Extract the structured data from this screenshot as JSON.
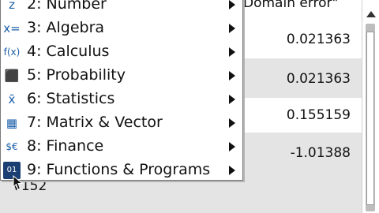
{
  "history": {
    "error_text": "Domain error\"",
    "results": [
      "0.021363",
      "0.021363",
      "0.155159",
      "-1.01388"
    ],
    "input_expr": "√152"
  },
  "menu": {
    "items": [
      {
        "icon": "number-icon",
        "glyph": "z",
        "label": "2: Number"
      },
      {
        "icon": "algebra-icon",
        "glyph": "x=",
        "label": "3: Algebra"
      },
      {
        "icon": "calculus-icon",
        "glyph": "f(x)",
        "label": "4: Calculus"
      },
      {
        "icon": "probability-icon",
        "glyph": "⬛",
        "label": "5: Probability"
      },
      {
        "icon": "statistics-icon",
        "glyph": "x̄",
        "label": "6: Statistics"
      },
      {
        "icon": "matrix-icon",
        "glyph": "▦",
        "label": "7: Matrix & Vector"
      },
      {
        "icon": "finance-icon",
        "glyph": "$€",
        "label": "8: Finance"
      },
      {
        "icon": "functions-programs-icon",
        "glyph": "01",
        "label": "9: Functions & Programs"
      }
    ]
  },
  "colors": {
    "menu_icon": "#1b5fa8",
    "gray_row": "#e4e4e4"
  }
}
